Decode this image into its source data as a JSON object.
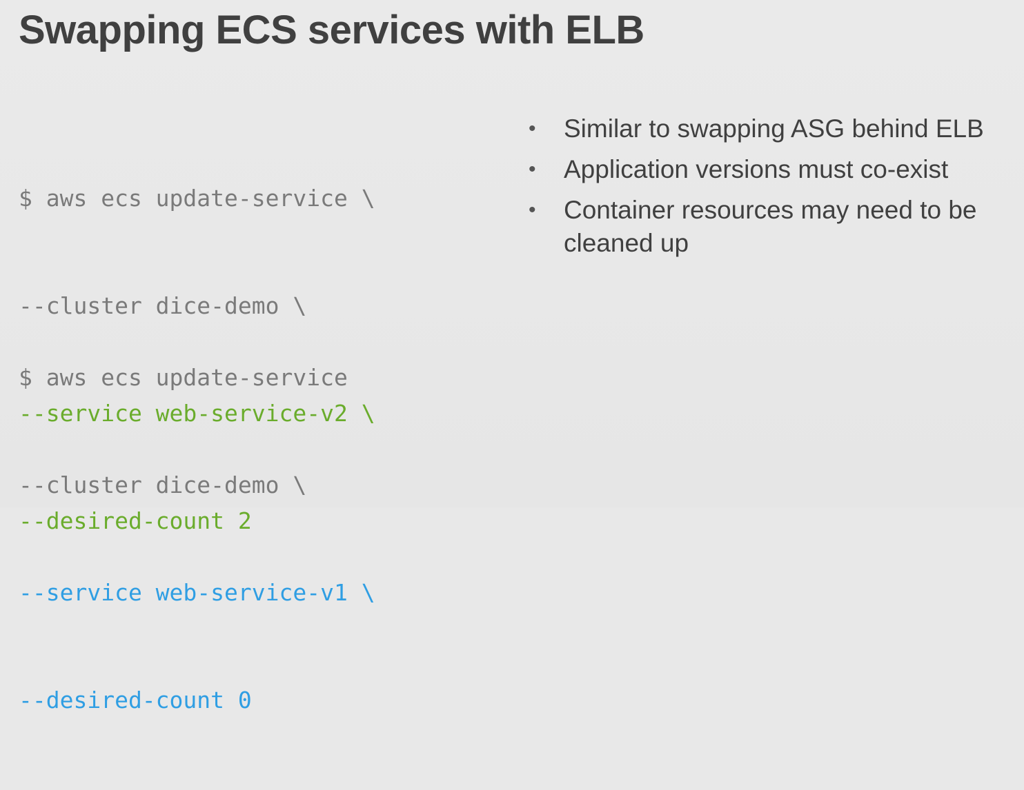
{
  "slide": {
    "title": "Swapping ECS services with ELB",
    "colors": {
      "background": "#e8e8e8",
      "title_text": "#404040",
      "code_default": "#7a7a7a",
      "code_new_service": "#6aac2c",
      "code_old_service": "#2f9ee3"
    },
    "code_blocks": [
      {
        "lines": [
          {
            "text": "$ aws ecs update-service \\",
            "color": "gray"
          },
          {
            "text": "--cluster dice-demo \\",
            "color": "gray"
          },
          {
            "text": "--service web-service-v2 \\",
            "color": "green"
          },
          {
            "text": "--desired-count 2",
            "color": "green"
          }
        ]
      },
      {
        "lines": [
          {
            "text": "$ aws ecs update-service",
            "color": "gray"
          },
          {
            "text": "--cluster dice-demo \\",
            "color": "gray"
          },
          {
            "text": "--service web-service-v1 \\",
            "color": "blue"
          },
          {
            "text": "--desired-count 0",
            "color": "blue"
          }
        ]
      }
    ],
    "bullets": [
      {
        "dot": "•",
        "text": "Similar to swapping ASG behind ELB"
      },
      {
        "dot": "•",
        "text": "Application versions must co-exist"
      },
      {
        "dot": "•",
        "text": "Container resources may need to be cleaned up"
      }
    ]
  }
}
